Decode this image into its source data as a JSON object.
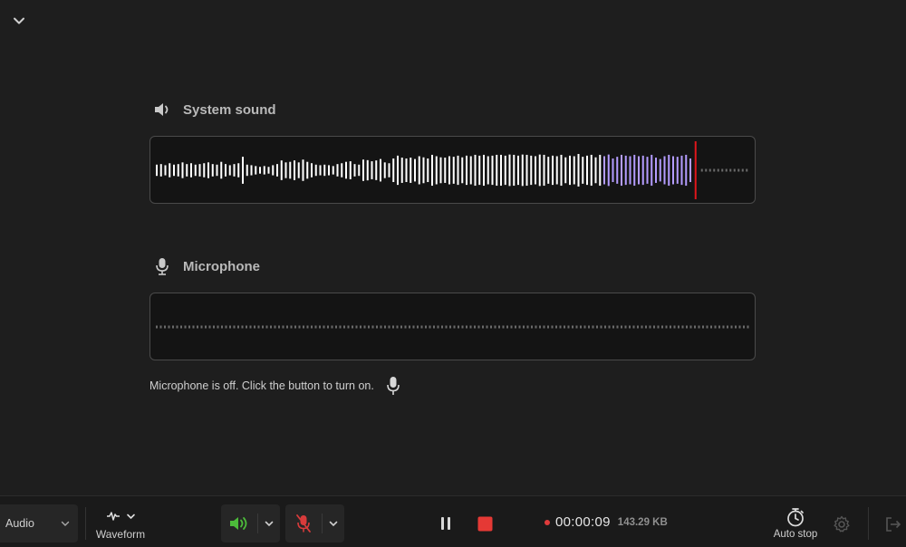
{
  "header": {
    "collapse_icon": "chevron-down-icon"
  },
  "system_sound": {
    "label": "System sound",
    "icon": "speaker-icon",
    "highlight_color": "#b49cff",
    "playhead_color": "#e0161b",
    "bar_levels": [
      0.2,
      0.22,
      0.18,
      0.25,
      0.2,
      0.22,
      0.28,
      0.22,
      0.25,
      0.2,
      0.22,
      0.25,
      0.28,
      0.22,
      0.2,
      0.3,
      0.22,
      0.18,
      0.22,
      0.25,
      0.48,
      0.2,
      0.18,
      0.15,
      0.12,
      0.15,
      0.12,
      0.18,
      0.22,
      0.35,
      0.28,
      0.3,
      0.35,
      0.28,
      0.38,
      0.3,
      0.25,
      0.2,
      0.18,
      0.2,
      0.18,
      0.15,
      0.22,
      0.25,
      0.3,
      0.32,
      0.22,
      0.2,
      0.38,
      0.36,
      0.32,
      0.35,
      0.4,
      0.28,
      0.25,
      0.42,
      0.52,
      0.45,
      0.42,
      0.45,
      0.4,
      0.5,
      0.46,
      0.42,
      0.55,
      0.5,
      0.46,
      0.45,
      0.5,
      0.48,
      0.52,
      0.46,
      0.52,
      0.5,
      0.55,
      0.52,
      0.55,
      0.5,
      0.52,
      0.55,
      0.55,
      0.52,
      0.56,
      0.55,
      0.52,
      0.56,
      0.55,
      0.52,
      0.5,
      0.56,
      0.55,
      0.48,
      0.52,
      0.5,
      0.55,
      0.46,
      0.52,
      0.5,
      0.58,
      0.48,
      0.52,
      0.55,
      0.46,
      0.55,
      0.5,
      0.56,
      0.42,
      0.48,
      0.55,
      0.52,
      0.5,
      0.55,
      0.5,
      0.52,
      0.48,
      0.55,
      0.45,
      0.4,
      0.5,
      0.55,
      0.5,
      0.48,
      0.52,
      0.55,
      0.42
    ],
    "highlight_from_index": 104
  },
  "microphone": {
    "label": "Microphone",
    "icon": "microphone-icon",
    "off_message": "Microphone is off. Click the button to turn on.",
    "turn_on_icon": "microphone-icon"
  },
  "toolbar": {
    "mode": {
      "value": "Audio",
      "icon": "chevron-down-icon"
    },
    "waveform": {
      "label": "Waveform",
      "icon": "waveform-icon"
    },
    "system_audio": {
      "icon": "speaker-icon",
      "color": "#4cbb3a",
      "dropdown_icon": "chevron-down-icon"
    },
    "mic_toggle": {
      "icon": "microphone-off-icon",
      "color": "#d83b3b",
      "dropdown_icon": "chevron-down-icon"
    },
    "pause": {
      "icon": "pause-icon"
    },
    "stop": {
      "icon": "stop-icon",
      "color": "#e53935"
    },
    "timer": {
      "time": "00:00:09",
      "size": "143.29 KB"
    },
    "auto_stop": {
      "label": "Auto stop",
      "icon": "stopwatch-icon"
    },
    "settings": {
      "icon": "gear-icon"
    },
    "exit": {
      "icon": "exit-icon"
    }
  }
}
